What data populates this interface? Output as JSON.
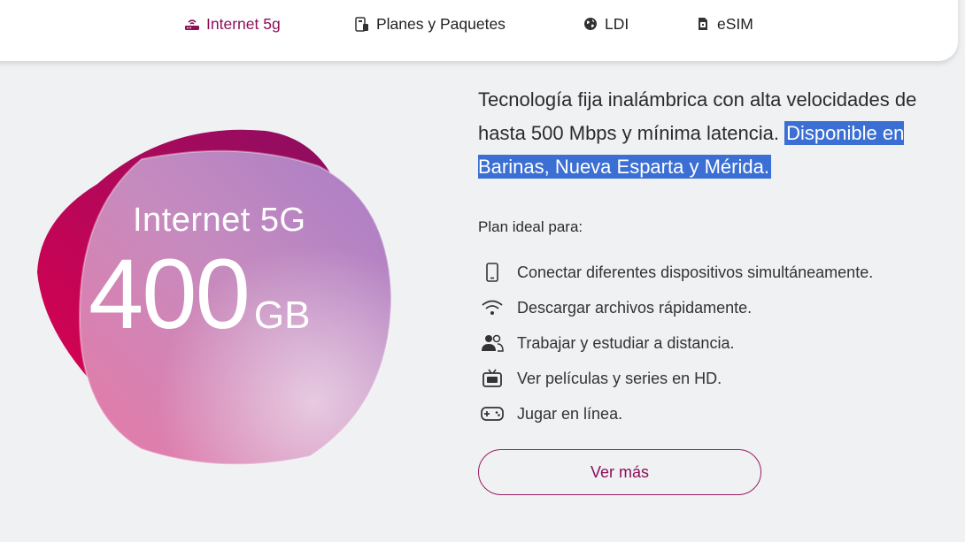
{
  "nav": {
    "tabs": [
      {
        "label": "Internet 5g",
        "icon": "router-icon",
        "active": true
      },
      {
        "label": "Planes y Paquetes",
        "icon": "sim-phone-icon",
        "active": false
      },
      {
        "label": "LDI",
        "icon": "globe-icon",
        "active": false
      },
      {
        "label": "eSIM",
        "icon": "esim-chip-icon",
        "active": false
      }
    ]
  },
  "hero": {
    "title": "Internet 5G",
    "amount": "400",
    "unit": "GB"
  },
  "description": {
    "text": "Tecnología fija inalámbrica con alta velocidades de hasta 500 Mbps y mínima latencia. ",
    "highlighted": "Disponible en Barinas, Nueva Esparta y Mérida."
  },
  "plan": {
    "label": "Plan ideal para:",
    "features": [
      {
        "icon": "smartphone-icon",
        "text": "Conectar diferentes dispositivos simultáneamente."
      },
      {
        "icon": "wifi-icon",
        "text": "Descargar archivos rápidamente."
      },
      {
        "icon": "users-icon",
        "text": "Trabajar y estudiar a distancia."
      },
      {
        "icon": "tv-icon",
        "text": "Ver películas y series en HD."
      },
      {
        "icon": "gamepad-icon",
        "text": "Jugar en línea."
      }
    ]
  },
  "cta": {
    "label": "Ver más"
  },
  "colors": {
    "brand": "#8c0f5a",
    "highlight": "#3b6fd3",
    "background": "#f0f1f3"
  }
}
